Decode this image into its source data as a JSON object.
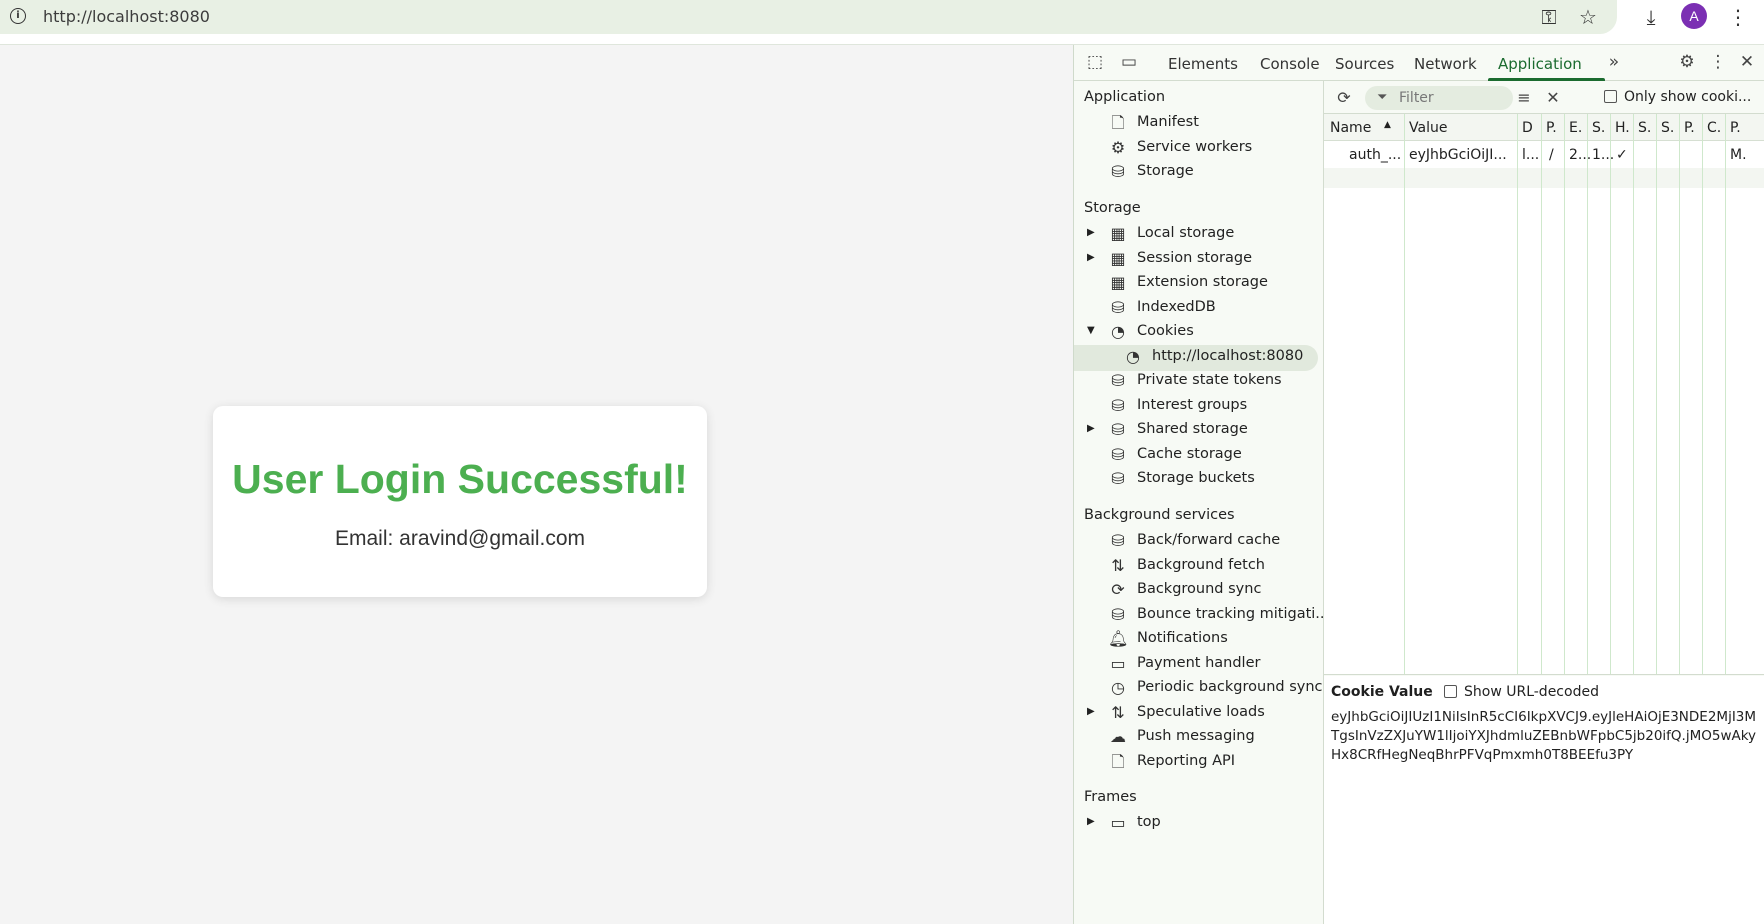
{
  "browser": {
    "url": "http://localhost:8080",
    "info_icon": "info-icon",
    "avatar_letter": "A"
  },
  "page": {
    "heading": "User Login Successful!",
    "email_line": "Email: aravind@gmail.com",
    "heading_color": "#4caf50"
  },
  "devtools": {
    "tabs": [
      "Elements",
      "Console",
      "Sources",
      "Network",
      "Application"
    ],
    "active_tab": "Application",
    "sidebar": {
      "sections": {
        "application": "Application",
        "storage": "Storage",
        "background_services": "Background services",
        "frames": "Frames"
      },
      "application_items": [
        "Manifest",
        "Service workers",
        "Storage"
      ],
      "storage_items": [
        "Local storage",
        "Session storage",
        "Extension storage",
        "IndexedDB",
        "Cookies"
      ],
      "cookies_child": "http://localhost:8080",
      "storage_items_2": [
        "Private state tokens",
        "Interest groups",
        "Shared storage",
        "Cache storage",
        "Storage buckets"
      ],
      "background_items": [
        "Back/forward cache",
        "Background fetch",
        "Background sync",
        "Bounce tracking mitigati...",
        "Notifications",
        "Payment handler",
        "Periodic background sync",
        "Speculative loads",
        "Push messaging",
        "Reporting API"
      ],
      "frames_items": [
        "top"
      ]
    },
    "cookies": {
      "filter_placeholder": "Filter",
      "only_show_label": "Only show cooki...",
      "columns": [
        "Name",
        "Value",
        "D",
        "P.",
        "E.",
        "S.",
        "H.",
        "S.",
        "S.",
        "P.",
        "C.",
        "P."
      ],
      "rows": [
        [
          "auth_...",
          "eyJhbGciOiJI...",
          "l...",
          "/",
          "2...",
          "1...",
          "✓",
          "",
          "",
          "",
          "",
          "M."
        ]
      ],
      "cookie_value_title": "Cookie Value",
      "show_url_decoded": "Show URL-decoded",
      "cookie_value": "eyJhbGciOiJIUzI1NiIsInR5cCI6IkpXVCJ9.eyJleHAiOjE3NDE2MjI3MTgsInVzZXJuYW1lIjoiYXJhdmluZEBnbWFpbC5jb20ifQ.jMO5wAkyHx8CRfHegNeqBhrPFVqPmxmh0T8BEEfu3PY"
    }
  }
}
